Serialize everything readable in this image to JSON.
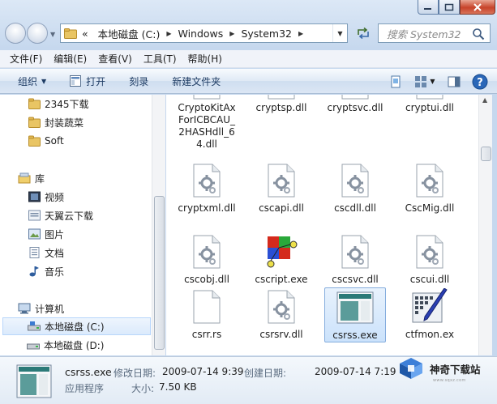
{
  "window": {
    "search_placeholder": "搜索 System32"
  },
  "address": {
    "overflow": "«",
    "crumbs": [
      "本地磁盘 (C:)",
      "Windows",
      "System32"
    ]
  },
  "menu": [
    "文件(F)",
    "编辑(E)",
    "查看(V)",
    "工具(T)",
    "帮助(H)"
  ],
  "toolbar": {
    "organize": "组织",
    "open": "打开",
    "burn": "刻录",
    "new_folder": "新建文件夹"
  },
  "nav": {
    "items": [
      "2345下载",
      "封装蔬菜",
      "Soft",
      "库",
      "视频",
      "天翼云下载",
      "图片",
      "文档",
      "音乐",
      "计算机",
      "本地磁盘 (C:)",
      "本地磁盘 (D:)"
    ]
  },
  "files": [
    {
      "name": "CryptoKitAxForICBCAU_2HASHdll_64.dll",
      "kind": "partial"
    },
    {
      "name": "cryptsp.dll",
      "kind": "partial"
    },
    {
      "name": "cryptsvc.dll",
      "kind": "partial"
    },
    {
      "name": "cryptui.dll",
      "kind": "partial"
    },
    {
      "name": "cryptxml.dll",
      "kind": "dll"
    },
    {
      "name": "cscapi.dll",
      "kind": "dll"
    },
    {
      "name": "cscdll.dll",
      "kind": "dll"
    },
    {
      "name": "CscMig.dll",
      "kind": "dll"
    },
    {
      "name": "cscobj.dll",
      "kind": "dll"
    },
    {
      "name": "cscript.exe",
      "kind": "script"
    },
    {
      "name": "cscsvc.dll",
      "kind": "dll"
    },
    {
      "name": "cscui.dll",
      "kind": "dll"
    },
    {
      "name": "csrr.rs",
      "kind": "blank"
    },
    {
      "name": "csrsrv.dll",
      "kind": "dll"
    },
    {
      "name": "csrss.exe",
      "kind": "exe"
    },
    {
      "name": "ctfmon.ex",
      "kind": "ctf"
    }
  ],
  "details": {
    "name": "csrss.exe",
    "modified_label": "修改日期:",
    "modified": "2009-07-14 9:39",
    "created_label": "创建日期:",
    "created": "2009-07-14 7:19",
    "type": "应用程序",
    "size_label": "大小:",
    "size": "7.50 KB"
  },
  "watermark": {
    "text": "神奇下载站",
    "url": "www.sqxz.com"
  },
  "colors": {
    "accent": "#1e3c64",
    "selection": "#cbe2fb",
    "selection_border": "#84acdd"
  }
}
